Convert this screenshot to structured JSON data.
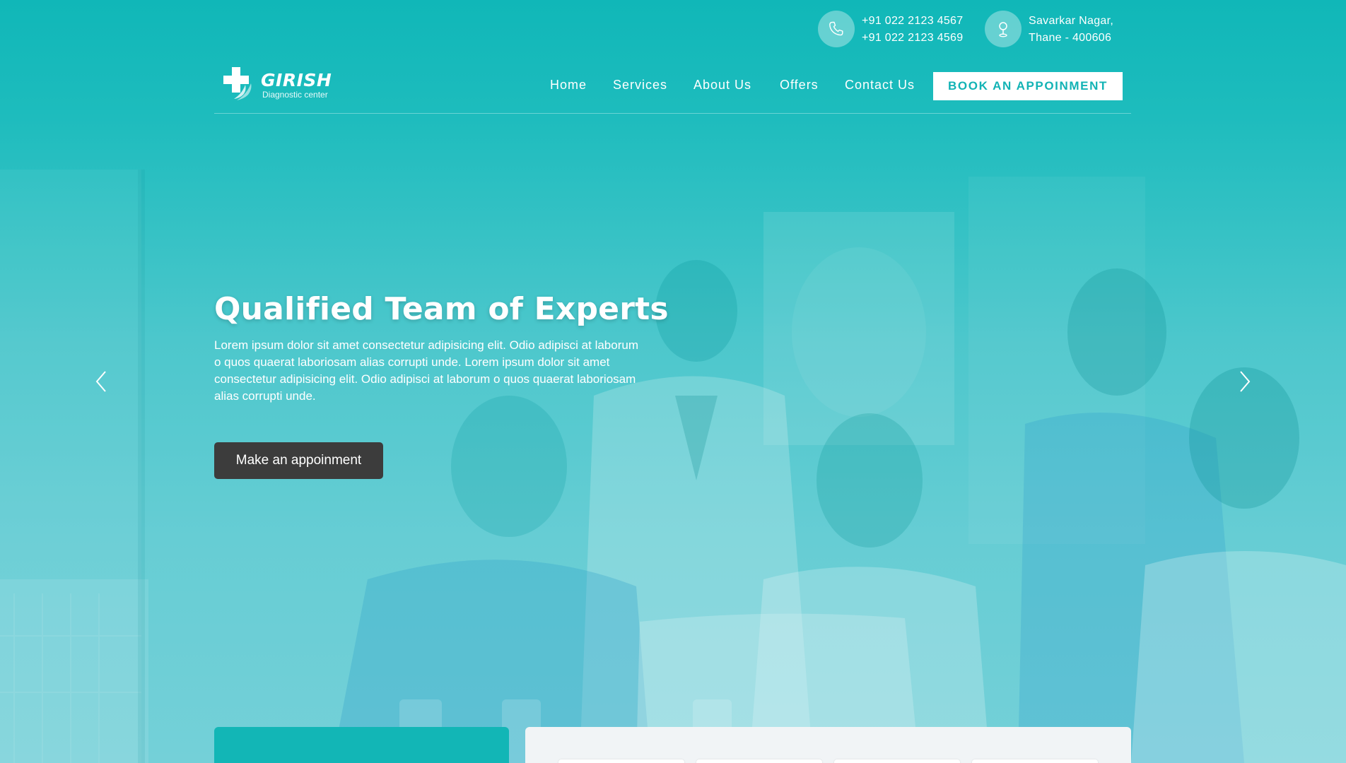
{
  "brand": {
    "name": "GIRISH",
    "tagline": "Diagnostic center"
  },
  "contact": {
    "phone_icon": "phone-icon",
    "phones": [
      "+91 022 2123 4567",
      "+91 022 2123 4569"
    ],
    "location_icon": "location-pin-icon",
    "address": [
      "Savarkar Nagar,",
      "Thane - 400606"
    ]
  },
  "nav": {
    "items": [
      {
        "label": "Home"
      },
      {
        "label": "Services"
      },
      {
        "label": "About Us"
      },
      {
        "label": "Offers"
      },
      {
        "label": "Contact Us"
      }
    ],
    "cta_label": "BOOK AN APPOINMENT"
  },
  "hero": {
    "title": "Qualified Team of Experts",
    "text": "Lorem ipsum dolor sit amet consectetur adipisicing elit. Odio adipisci at laborum o quos quaerat laboriosam alias corrupti unde. Lorem ipsum dolor sit amet consectetur adipisicing elit. Odio adipisci at laborum o quos quaerat laboriosam alias corrupti unde.",
    "button_label": "Make an appoinment",
    "prev_icon": "chevron-left-icon",
    "next_icon": "chevron-right-icon"
  },
  "colors": {
    "primary": "#12b8b8",
    "button_dark": "#3c3c3c",
    "white": "#ffffff"
  }
}
